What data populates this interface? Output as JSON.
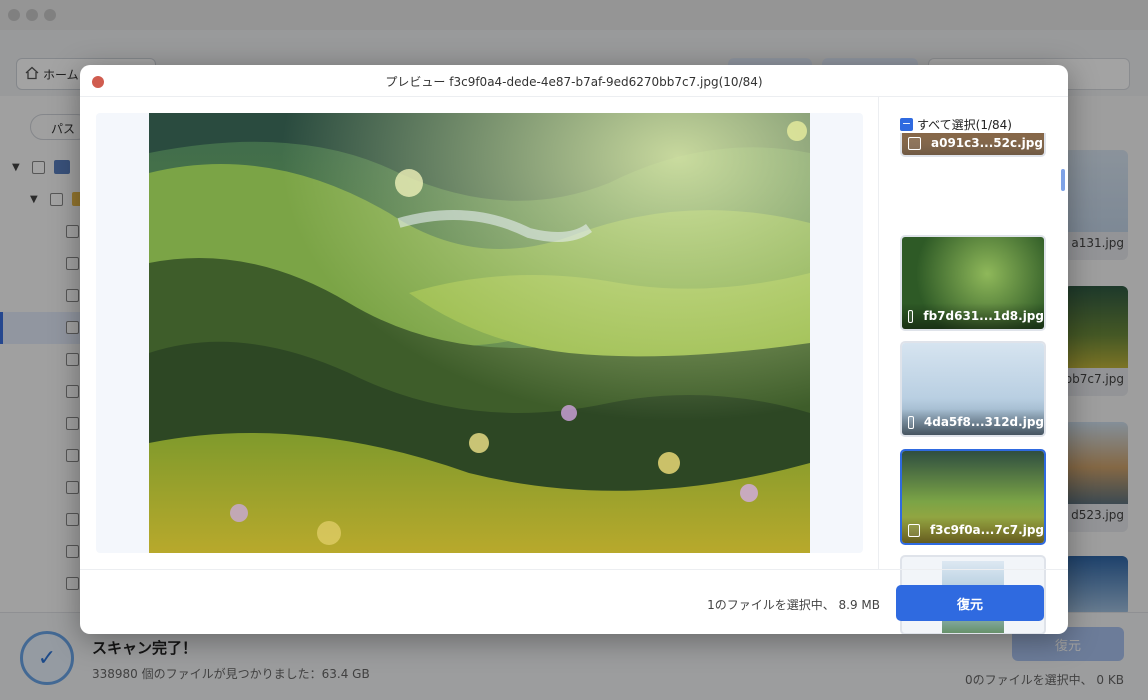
{
  "app": {
    "toolbar": {
      "home_label": "ホーム"
    },
    "left_panel": {
      "path_label": "パス"
    },
    "right_strip": {
      "thumb_labels": [
        "a131.jpg",
        "bb7c7.jpg",
        "d523.jpg"
      ]
    },
    "bottom": {
      "scan_title": "スキャン完了！",
      "scan_sub": "338980 個のファイルが見つかりました：63.4 GB",
      "recover_label": "復元",
      "sel_info": "0のファイルを選択中、 0 KB"
    }
  },
  "preview": {
    "title": "プレビュー f3c9f0a4-dede-4e87-b7af-9ed6270bb7c7.jpg(10/84)",
    "select_all_label": "すべて選択(1/84)",
    "thumbnails": [
      {
        "name": "a091c3...52c.jpg"
      },
      {
        "name": "fb7d631...1d8.jpg"
      },
      {
        "name": "4da5f8...312d.jpg"
      },
      {
        "name": "f3c9f0a...7c7.jpg"
      },
      {
        "name": ""
      }
    ],
    "footer": {
      "sel_info": "1のファイルを選択中、 8.9 MB",
      "recover_label": "復元"
    }
  },
  "colors": {
    "accent": "#2f6ae0",
    "close": "#d05c4f"
  }
}
